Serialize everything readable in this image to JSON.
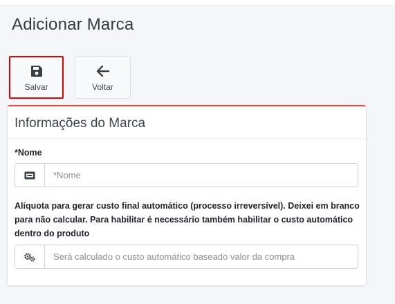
{
  "page": {
    "title": "Adicionar Marca"
  },
  "toolbar": {
    "save_label": "Salvar",
    "save_icon": "floppy-disk-icon",
    "back_label": "Voltar",
    "back_icon": "arrow-left-icon"
  },
  "card": {
    "title": "Informações do Marca",
    "accent_color": "#e34b43"
  },
  "fields": {
    "name": {
      "label": "*Nome",
      "placeholder": "*Nome",
      "value": "",
      "icon": "id-card-icon"
    },
    "aliquota": {
      "label": "Alíquota para gerar custo final automático (processo irreversível). Deixei em branco para não calcular. Para habilitar é necessário também habilitar o custo automático dentro do produto",
      "placeholder": "Será calculado o custo automático baseado valor da compra",
      "value": "",
      "icon": "gears-icon"
    }
  },
  "highlight_color": "#e00000"
}
